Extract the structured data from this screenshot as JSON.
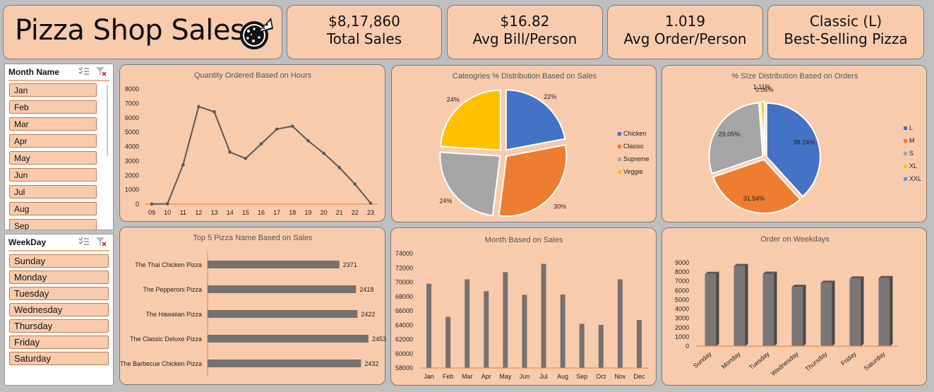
{
  "title": "Pizza Shop Sales",
  "kpis": [
    {
      "value": "$8,17,860",
      "label": "Total Sales"
    },
    {
      "value": "$16.82",
      "label": "Avg Bill/Person"
    },
    {
      "value": "1.019",
      "label": "Avg Order/Person"
    },
    {
      "value": "Classic (L)",
      "label": "Best-Selling Pizza"
    }
  ],
  "slicers": {
    "month": {
      "header": "Month Name",
      "items": [
        "Jan",
        "Feb",
        "Mar",
        "Apr",
        "May",
        "Jun",
        "Jul",
        "Aug",
        "Sep"
      ]
    },
    "weekday": {
      "header": "WeekDay",
      "items": [
        "Sunday",
        "Monday",
        "Tuesday",
        "Wednesday",
        "Thursday",
        "Friday",
        "Saturday"
      ]
    }
  },
  "colors": {
    "card": "#f8cbad",
    "accent": "#ed7d31",
    "bar": "#767171",
    "line": "#595959"
  },
  "chart_data": [
    {
      "type": "line",
      "title": "Quantity Ordered Based on Hours",
      "x": [
        "09",
        "10",
        "11",
        "12",
        "13",
        "14",
        "15",
        "16",
        "17",
        "18",
        "19",
        "20",
        "21",
        "22",
        "23"
      ],
      "values": [
        4,
        18,
        2728,
        6776,
        6413,
        3613,
        3170,
        4185,
        5211,
        5417,
        4406,
        3534,
        2545,
        1386,
        68
      ],
      "ylim": [
        0,
        8000
      ],
      "yticks": [
        "8000",
        "7000",
        "6000",
        "5000",
        "4000",
        "3000",
        "2000",
        "1000",
        "0"
      ]
    },
    {
      "type": "pie",
      "title": "Cateogries % Distribution Based on Sales",
      "categories": [
        "Chicken",
        "Classic",
        "Supreme",
        "Veggie"
      ],
      "values": [
        22,
        30,
        24,
        24
      ],
      "labels": [
        "22%",
        "30%",
        "24%",
        "24%"
      ],
      "colors": [
        "#4472c4",
        "#ed7d31",
        "#a5a5a5",
        "#ffc000"
      ],
      "legend": "right"
    },
    {
      "type": "pie",
      "title": "% SIze Distribution Based on Orders",
      "categories": [
        "L",
        "M",
        "S",
        "XL",
        "XXL"
      ],
      "values": [
        38.24,
        31.54,
        29.05,
        1.11,
        0.06
      ],
      "labels": [
        "38.24%",
        "31.54%",
        "29.05%",
        "1.11%",
        "0.06%"
      ],
      "colors": [
        "#4472c4",
        "#ed7d31",
        "#a5a5a5",
        "#ffc000",
        "#5b9bd5"
      ],
      "legend": "right"
    },
    {
      "type": "bar",
      "orientation": "horizontal",
      "title": "Top 5 Pizza Name Based on Sales",
      "categories": [
        "The Thai Chicken Pizza",
        "The Pepperoni Pizza",
        "The Hawaiian Pizza",
        "The Classic Deluxe Pizza",
        "The Barbecue Chicken Pizza"
      ],
      "values": [
        2371,
        2418,
        2422,
        2453,
        2432
      ],
      "labels": [
        "2371",
        "2418",
        "2422",
        "2453",
        "2432"
      ]
    },
    {
      "type": "bar",
      "title": "Month Based on Sales",
      "categories": [
        "Jan",
        "Feb",
        "Mar",
        "Apr",
        "May",
        "Jun",
        "Jul",
        "Aug",
        "Sep",
        "Oct",
        "Nov",
        "Dec"
      ],
      "values": [
        69793,
        65160,
        70397,
        68737,
        71403,
        68230,
        72558,
        68278,
        64180,
        64028,
        70395,
        64701
      ],
      "ylim": [
        58000,
        74000
      ],
      "yticks": [
        "74000",
        "72000",
        "70000",
        "68000",
        "66000",
        "64000",
        "62000",
        "60000",
        "58000"
      ]
    },
    {
      "type": "bar",
      "title": "Order on Weekdays",
      "categories": [
        "Sunday",
        "Monday",
        "Tuesday",
        "Wednesday",
        "Thursday",
        "Friday",
        "Saturday"
      ],
      "values": [
        7800,
        8650,
        7820,
        6400,
        6850,
        7300,
        7350
      ],
      "ylim": [
        0,
        9000
      ],
      "yticks": [
        "9000",
        "8000",
        "7000",
        "6000",
        "5000",
        "4000",
        "3000",
        "2000",
        "1000",
        "0"
      ]
    }
  ]
}
